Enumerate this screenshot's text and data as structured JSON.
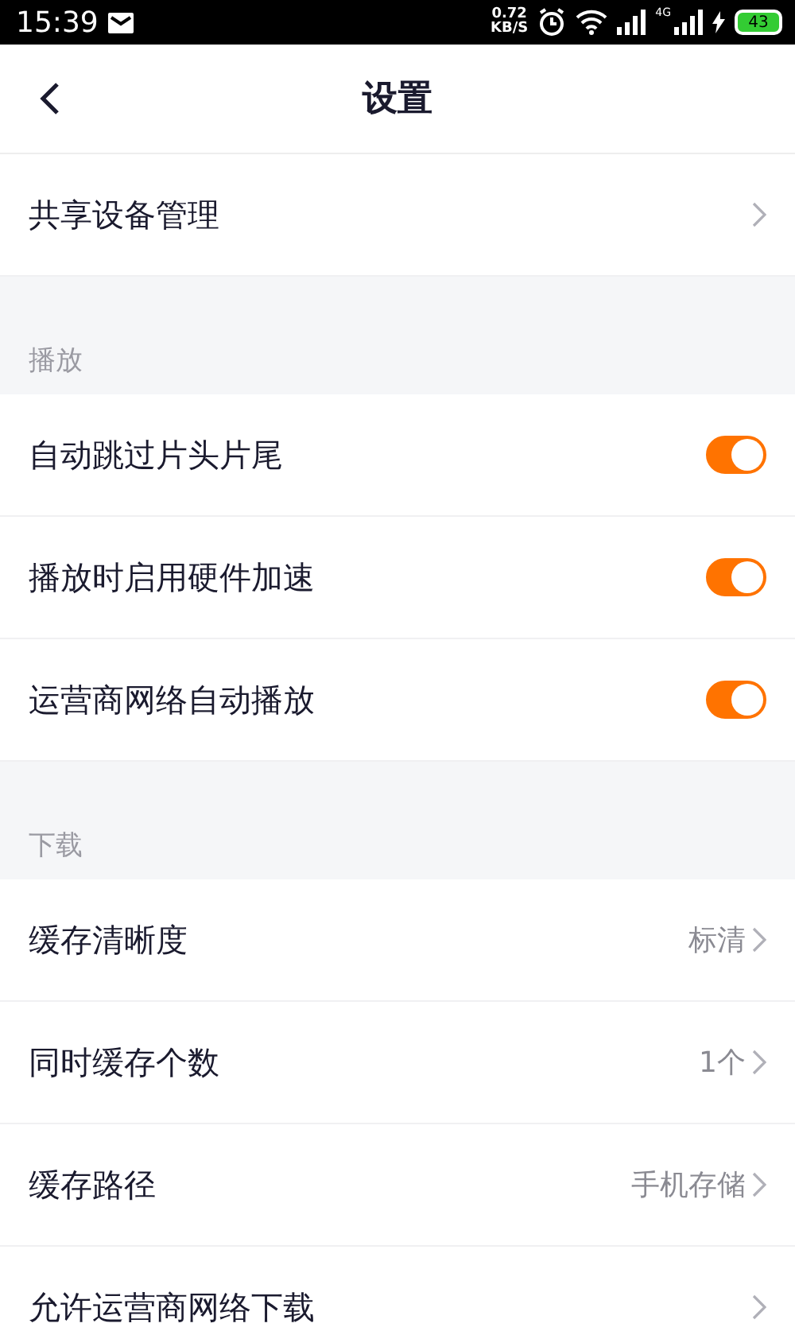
{
  "status_bar": {
    "time": "15:39",
    "speed_value": "0.72",
    "speed_unit": "KB/S",
    "network": "4G",
    "battery": "43"
  },
  "header": {
    "title": "设置"
  },
  "sections": [
    {
      "items": [
        {
          "kind": "link",
          "label": "共享设备管理"
        }
      ]
    },
    {
      "title": "播放",
      "items": [
        {
          "kind": "toggle",
          "label": "自动跳过片头片尾",
          "on": true
        },
        {
          "kind": "toggle",
          "label": "播放时启用硬件加速",
          "on": true
        },
        {
          "kind": "toggle",
          "label": "运营商网络自动播放",
          "on": true
        }
      ]
    },
    {
      "title": "下载",
      "items": [
        {
          "kind": "link",
          "label": "缓存清晰度",
          "value": "标清"
        },
        {
          "kind": "link",
          "label": "同时缓存个数",
          "value": "1个"
        },
        {
          "kind": "link",
          "label": "缓存路径",
          "value": "手机存储"
        },
        {
          "kind": "link",
          "label": "允许运营商网络下载"
        }
      ]
    }
  ]
}
